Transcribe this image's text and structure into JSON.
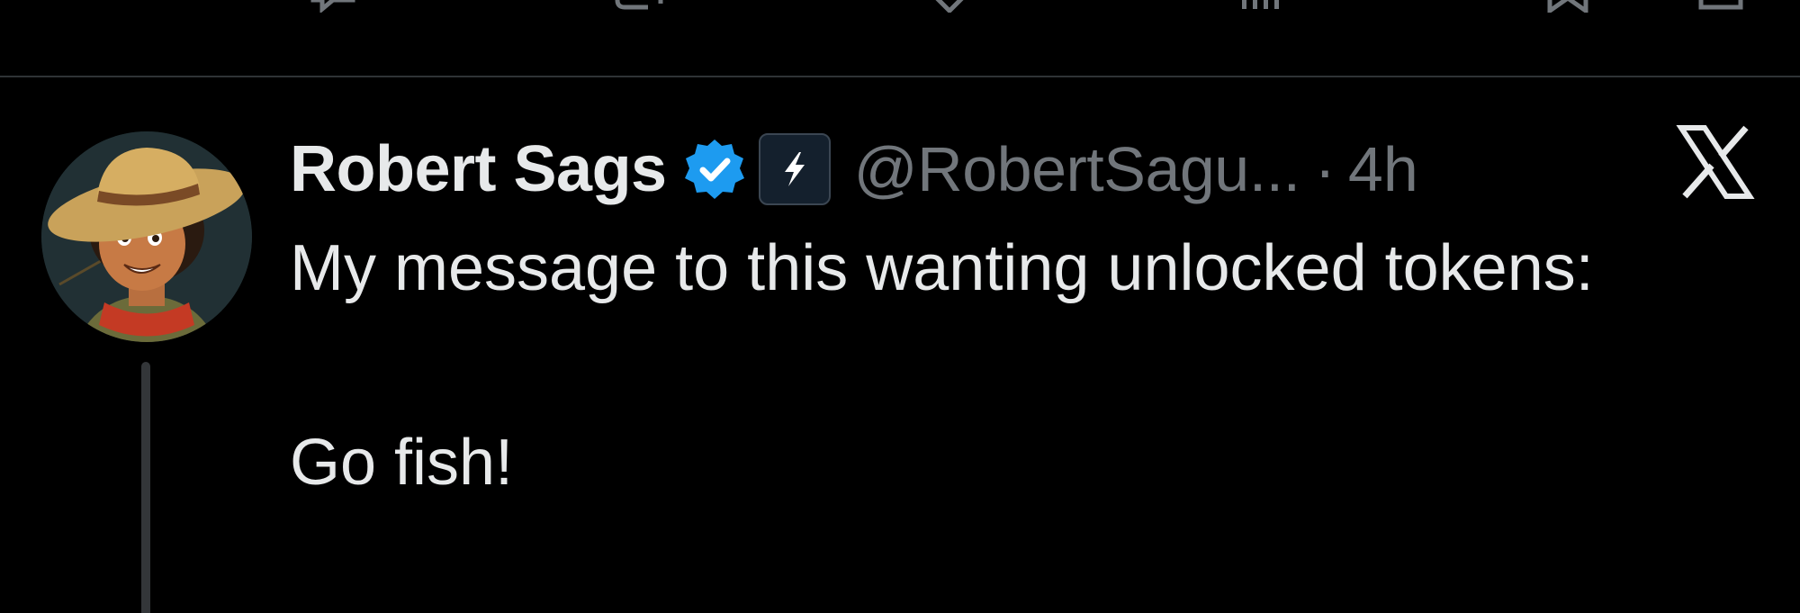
{
  "post": {
    "display_name": "Robert Sags",
    "handle": "@RobertSagu...",
    "separator": "·",
    "timestamp": "4h",
    "text_line_1": "My message to this wanting unlocked tokens:",
    "text_line_2": "Go fish!",
    "verified": true,
    "verified_color": "#1d9bf0",
    "affiliate_badge_icon": "lightning-bolt-icon",
    "platform_logo": "x-logo-icon"
  },
  "action_bar": {
    "icons": [
      "reply-icon",
      "repost-icon",
      "like-icon",
      "views-icon",
      "bookmark-icon",
      "share-icon"
    ]
  },
  "colors": {
    "background": "#000000",
    "primary_text": "#e7e9ea",
    "secondary_text": "#71767b",
    "divider": "#2f3336",
    "thread_line": "#333639"
  }
}
